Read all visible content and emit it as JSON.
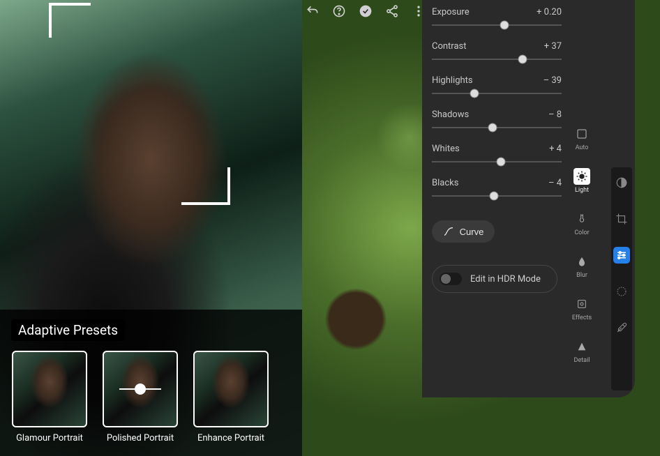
{
  "presets": {
    "title": "Adaptive Presets",
    "items": [
      {
        "label": "Glamour Portrait"
      },
      {
        "label": "Polished Portrait"
      },
      {
        "label": "Enhance Portrait"
      }
    ]
  },
  "light": {
    "sliders": [
      {
        "label": "Exposure",
        "value": "+ 0.20",
        "pos": 56
      },
      {
        "label": "Contrast",
        "value": "+ 37",
        "pos": 70
      },
      {
        "label": "Highlights",
        "value": "– 39",
        "pos": 33
      },
      {
        "label": "Shadows",
        "value": "– 8",
        "pos": 47
      },
      {
        "label": "Whites",
        "value": "+ 4",
        "pos": 53
      },
      {
        "label": "Blacks",
        "value": "– 4",
        "pos": 48
      }
    ],
    "curve_button": "Curve",
    "hdr_label": "Edit in HDR Mode"
  },
  "rail_inner": [
    {
      "name": "auto",
      "label": "Auto"
    },
    {
      "name": "light",
      "label": "Light"
    },
    {
      "name": "color",
      "label": "Color"
    },
    {
      "name": "blur",
      "label": "Blur"
    },
    {
      "name": "effects",
      "label": "Effects"
    },
    {
      "name": "detail",
      "label": "Detail"
    }
  ],
  "rail_outer": [
    {
      "icon": "circle-half"
    },
    {
      "icon": "crop"
    },
    {
      "icon": "sliders",
      "active": true
    },
    {
      "icon": "sun"
    },
    {
      "icon": "eyedropper"
    }
  ],
  "topbar": {
    "icons": [
      "undo",
      "help",
      "check",
      "share",
      "more"
    ]
  }
}
